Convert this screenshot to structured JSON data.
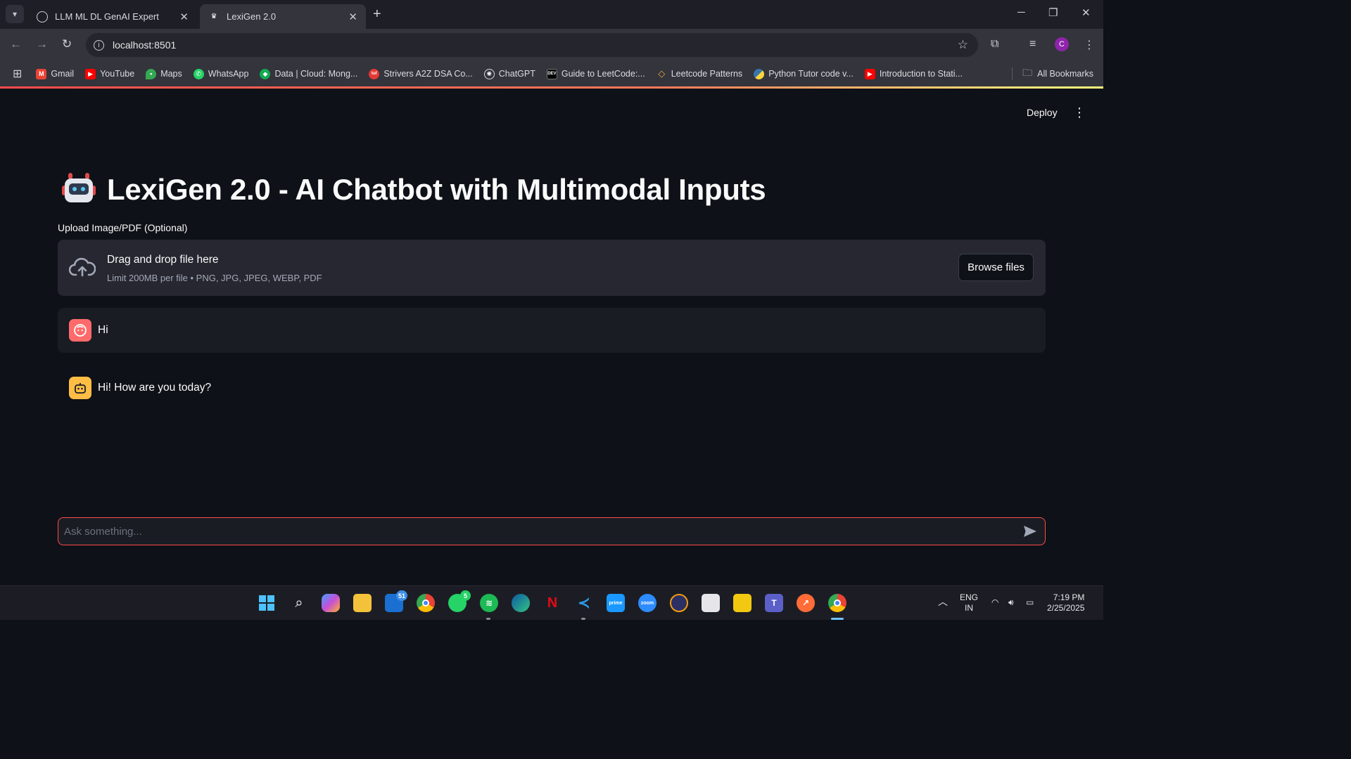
{
  "browser": {
    "tabs": [
      {
        "title": "LLM ML DL GenAI Expert",
        "active": false
      },
      {
        "title": "LexiGen 2.0",
        "active": true
      }
    ],
    "url": "localhost:8501",
    "profile_initial": "C",
    "bookmarks": [
      {
        "label": "Gmail",
        "icon": "gmail-icon",
        "color": "#ea4335"
      },
      {
        "label": "YouTube",
        "icon": "youtube-icon",
        "color": "#ff0000"
      },
      {
        "label": "Maps",
        "icon": "maps-icon",
        "color": "#34a853"
      },
      {
        "label": "WhatsApp",
        "icon": "whatsapp-icon",
        "color": "#25d366"
      },
      {
        "label": "Data | Cloud: Mong...",
        "icon": "mongodb-icon",
        "color": "#13aa52"
      },
      {
        "label": "Strivers A2Z DSA Co...",
        "icon": "tuf-icon",
        "color": "#e53935"
      },
      {
        "label": "ChatGPT",
        "icon": "chatgpt-icon",
        "color": "#444654"
      },
      {
        "label": "Guide to LeetCode:...",
        "icon": "dev-icon",
        "color": "#000000"
      },
      {
        "label": "Leetcode Patterns",
        "icon": "leetcode-icon",
        "color": "#f0a63a"
      },
      {
        "label": "Python Tutor code v...",
        "icon": "python-icon",
        "color": "#3776ab"
      },
      {
        "label": "Introduction to Stati...",
        "icon": "youtube-icon",
        "color": "#ff0000"
      }
    ],
    "all_bookmarks_label": "All Bookmarks"
  },
  "app": {
    "deploy_label": "Deploy",
    "title": "LexiGen 2.0 - AI Chatbot with Multimodal Inputs",
    "upload": {
      "label": "Upload Image/PDF (Optional)",
      "drop_title": "Drag and drop file here",
      "drop_hint": "Limit 200MB per file • PNG, JPG, JPEG, WEBP, PDF",
      "browse_label": "Browse files"
    },
    "messages": [
      {
        "role": "user",
        "text": "Hi"
      },
      {
        "role": "assistant",
        "text": "Hi! How are you today?"
      }
    ],
    "chat_input": {
      "placeholder": "Ask something...",
      "value": ""
    }
  },
  "taskbar": {
    "badges": {
      "mail": "51",
      "whatsapp": "5"
    },
    "lang_top": "ENG",
    "lang_bottom": "IN",
    "time": "7:19 PM",
    "date": "2/25/2025"
  },
  "colors": {
    "accent": "#ff4b4b",
    "background": "#0e1117",
    "surface": "#262730"
  }
}
